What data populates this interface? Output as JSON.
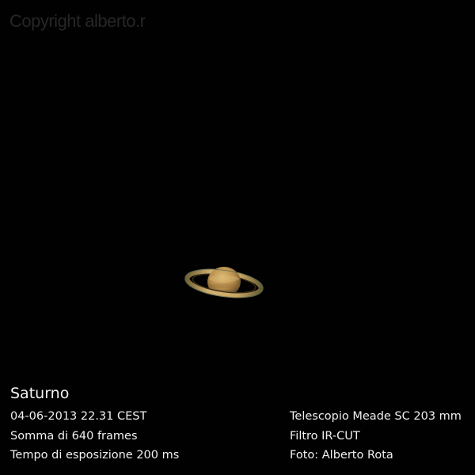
{
  "watermark": "Copyright alberto.r",
  "title": "Saturno",
  "details_left": [
    "04-06-2013 22.31 CEST",
    "Somma di 640 frames",
    "Tempo di esposizione 200 ms"
  ],
  "details_right": [
    "Telescopio Meade SC 203 mm",
    "Filtro IR-CUT",
    "Foto: Alberto Rota"
  ],
  "colors": {
    "background": "#010101",
    "text": "#f2f2f2",
    "watermark": "#262626",
    "ring": "#c8a25e",
    "planet_body": "#c49a55"
  },
  "icons": {
    "planet": "saturn-icon"
  }
}
